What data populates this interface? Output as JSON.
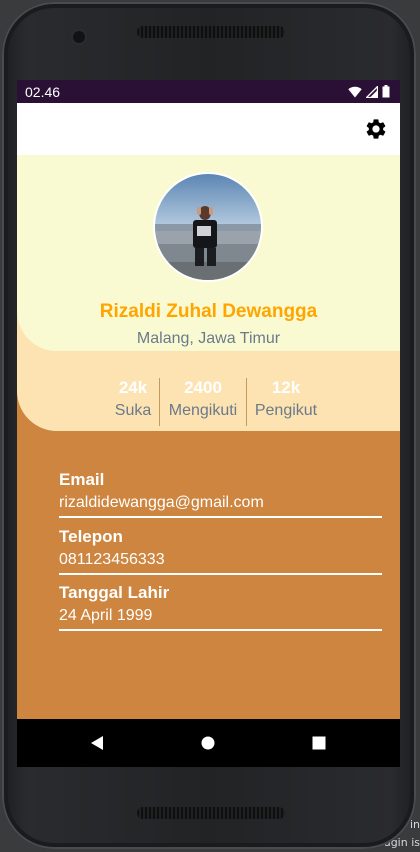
{
  "status_bar": {
    "time": "02.46"
  },
  "profile": {
    "name": "Rizaldi Zuhal Dewangga",
    "location": "Malang, Jawa Timur"
  },
  "stats": [
    {
      "value": "24k",
      "label": "Suka"
    },
    {
      "value": "2400",
      "label": "Mengikuti"
    },
    {
      "value": "12k",
      "label": "Pengikut"
    }
  ],
  "info": [
    {
      "label": "Email",
      "value": "rizaldidewangga@gmail.com"
    },
    {
      "label": "Telepon",
      "value": "081123456333"
    },
    {
      "label": "Tanggal Lahir",
      "value": "24 April 1999"
    }
  ],
  "desktop_overlay": {
    "line1": "in",
    "line2": "...Plugin is"
  },
  "colors": {
    "name": "#ffa500",
    "header_top": "#fafad2",
    "header_stats": "#fde3b1",
    "body": "#cd853f",
    "status_bar": "#2b1036"
  },
  "icons": {
    "appbar": "gear-icon",
    "nav": [
      "back-icon",
      "home-icon",
      "recents-icon"
    ]
  }
}
